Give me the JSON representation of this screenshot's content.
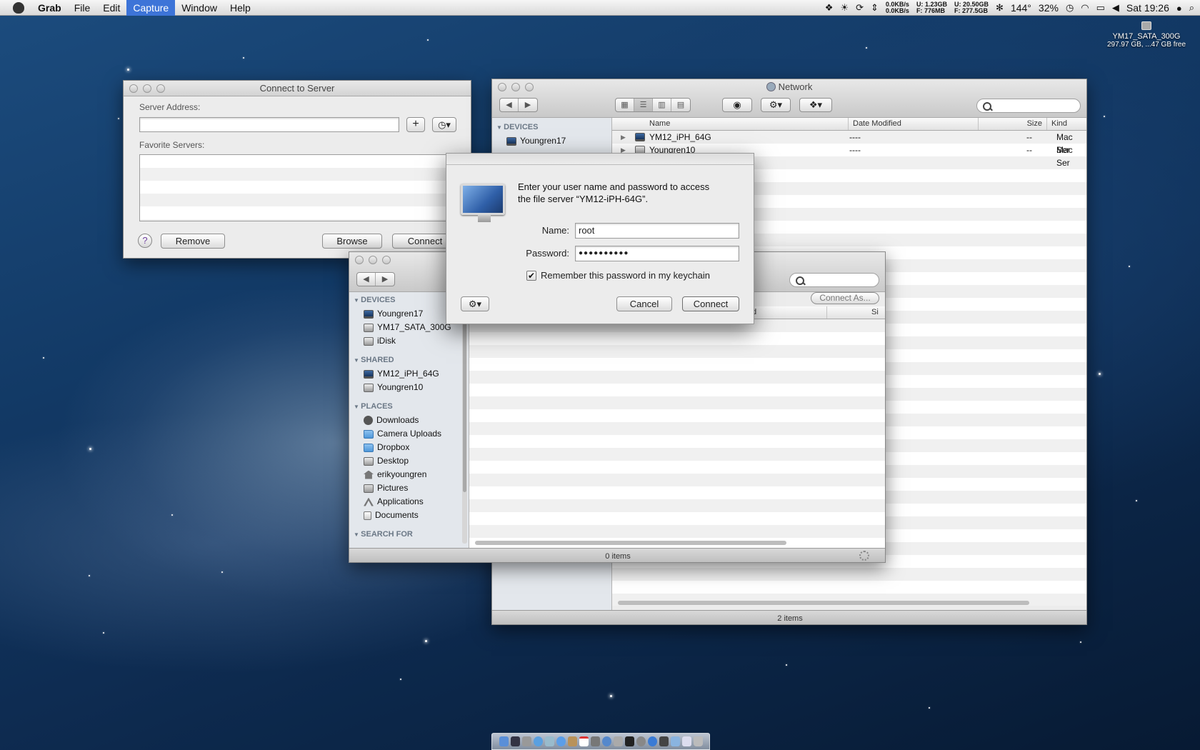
{
  "menubar": {
    "apple_icon": "apple-icon",
    "app_name": "Grab",
    "menus": [
      "File",
      "Edit",
      "Capture",
      "Window",
      "Help"
    ],
    "active_menu": "Capture",
    "status": {
      "net_down": "0.0KB/s",
      "net_up": "0.0KB/s",
      "mem_u": "U:",
      "mem_u_val": "1.23GB",
      "mem_f": "F:",
      "mem_f_val": "776MB",
      "disk_u": "U:",
      "disk_u_val": "20.50GB",
      "disk_f": "F:",
      "disk_f_val": "277.5GB",
      "temp": "144°",
      "battery": "32%",
      "clock": "Sat 19:26"
    }
  },
  "desktop_disk": {
    "name": "YM17_SATA_300G",
    "info": "297.97 GB, ...47 GB free"
  },
  "connect_to_server": {
    "title": "Connect to Server",
    "server_address_label": "Server Address:",
    "server_address_value": "",
    "favorite_servers_label": "Favorite Servers:",
    "add_label": "+",
    "help_label": "?",
    "remove_label": "Remove",
    "browse_label": "Browse",
    "connect_label": "Connect"
  },
  "network_window": {
    "title": "Network",
    "sidebar_devices_header": "DEVICES",
    "sidebar_device": "Youngren17",
    "columns": [
      "Name",
      "Date Modified",
      "Size",
      "Kind"
    ],
    "rows": [
      {
        "name": "YM12_iPH_64G",
        "modified": "----",
        "size": "--",
        "kind": "Mac Ser"
      },
      {
        "name": "Youngren10",
        "modified": "----",
        "size": "--",
        "kind": "Mac Ser"
      }
    ],
    "status": "2 items"
  },
  "finder_window": {
    "sections": [
      {
        "header": "DEVICES",
        "items": [
          "Youngren17",
          "YM17_SATA_300G",
          "iDisk"
        ]
      },
      {
        "header": "SHARED",
        "items": [
          "YM12_iPH_64G",
          "Youngren10"
        ]
      },
      {
        "header": "PLACES",
        "items": [
          "Downloads",
          "Camera Uploads",
          "Dropbox",
          "Desktop",
          "erikyoungren",
          "Pictures",
          "Applications",
          "Documents"
        ]
      }
    ],
    "search_for_header": "SEARCH FOR",
    "connect_as_label": "Connect As...",
    "col_modified_partial": "ified",
    "col_size_partial": "Si",
    "status": "0 items"
  },
  "auth_dialog": {
    "message_line1": "Enter your user name and password to access",
    "message_line2": "the file server “YM12-iPH-64G”.",
    "name_label": "Name:",
    "name_value": "root",
    "password_label": "Password:",
    "password_value": "●●●●●●●●●●",
    "remember_label": "Remember this password in my keychain",
    "remember_checked": true,
    "cancel_label": "Cancel",
    "connect_label": "Connect"
  }
}
